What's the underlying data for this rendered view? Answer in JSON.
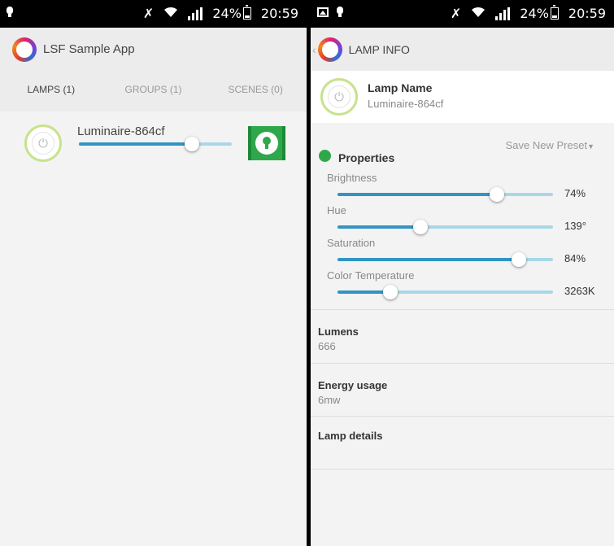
{
  "status_bar": {
    "left": {
      "battery_text": "24%",
      "time": "20:59"
    },
    "right": {
      "battery_text": "24%",
      "time": "20:59"
    }
  },
  "lamps_screen": {
    "title": "LSF Sample App",
    "tabs": [
      {
        "label": "LAMPS (1)",
        "active": true
      },
      {
        "label": "GROUPS (1)",
        "active": false
      },
      {
        "label": "SCENES (0)",
        "active": false
      }
    ],
    "lamp": {
      "name": "Luminaire-864cf",
      "brightness_fraction": 0.74,
      "color": "#2ea84a"
    }
  },
  "lamp_info_screen": {
    "title": "LAMP INFO",
    "name_label": "Lamp Name",
    "name_value": "Luminaire-864cf",
    "save_preset": "Save New Preset",
    "properties_title": "Properties",
    "properties_color": "#2ea84a",
    "properties": [
      {
        "label": "Brightness",
        "value_text": "74%",
        "fraction": 0.74
      },
      {
        "label": "Hue",
        "value_text": "139°",
        "fraction": 0.386
      },
      {
        "label": "Saturation",
        "value_text": "84%",
        "fraction": 0.84
      },
      {
        "label": "Color Temperature",
        "value_text": "3263K",
        "fraction": 0.245
      }
    ],
    "lumens": {
      "label": "Lumens",
      "value": "666"
    },
    "energy": {
      "label": "Energy usage",
      "value": "6mw"
    },
    "details": {
      "label": "Lamp details"
    }
  },
  "icons": [
    "bulb-icon",
    "image-icon",
    "mute-icon",
    "wifi-icon",
    "signal-icon",
    "battery-icon",
    "power-icon",
    "back-chevron-icon",
    "dropdown-arrow-icon",
    "light-bulb-icon"
  ]
}
